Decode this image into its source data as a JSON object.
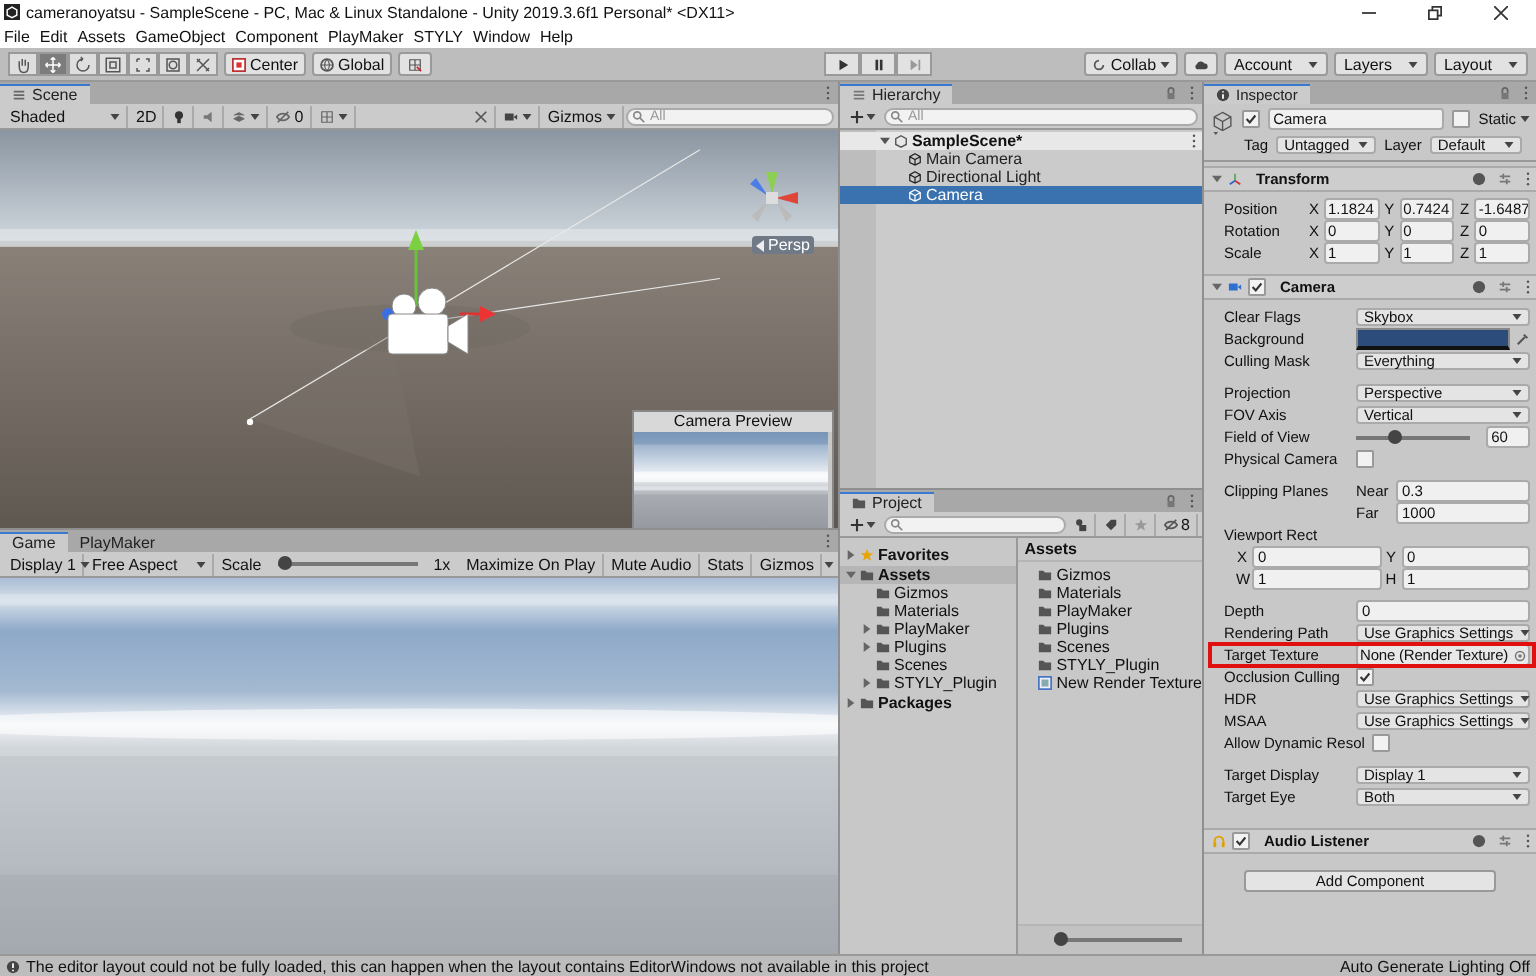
{
  "window": {
    "title": "cameranoyatsu - SampleScene - PC, Mac & Linux Standalone - Unity 2019.3.6f1 Personal* <DX11>"
  },
  "menu": [
    "File",
    "Edit",
    "Assets",
    "GameObject",
    "Component",
    "PlayMaker",
    "STYLY",
    "Window",
    "Help"
  ],
  "toolbar": {
    "tools": [
      {
        "kind": "hand",
        "selected": false
      },
      {
        "kind": "move",
        "selected": true
      },
      {
        "kind": "rotate",
        "selected": false
      },
      {
        "kind": "scale",
        "selected": false
      },
      {
        "kind": "rect",
        "selected": false
      },
      {
        "kind": "transform",
        "selected": false
      },
      {
        "kind": "custom",
        "selected": false
      }
    ],
    "pivot": "Center",
    "space": "Global",
    "collab": "Collab",
    "account": "Account",
    "layers": "Layers",
    "layout": "Layout"
  },
  "scene": {
    "tab": "Scene",
    "shading": "Shaded",
    "mode_2d": "2D",
    "hidden_count": "0",
    "gizmos": "Gizmos",
    "search": {
      "placeholder": "All"
    },
    "view_label": "Persp",
    "preview_title": "Camera Preview"
  },
  "game": {
    "tabs": [
      {
        "label": "Game",
        "selected": true
      },
      {
        "label": "PlayMaker",
        "selected": false
      }
    ],
    "display": "Display 1",
    "aspect": "Free Aspect",
    "scale_label": "Scale",
    "scale": {
      "level": 0.04
    },
    "scale_value": "1x",
    "buttons": [
      "Maximize On Play",
      "Mute Audio",
      "Stats",
      "Gizmos"
    ]
  },
  "hierarchy": {
    "tab": "Hierarchy",
    "search": {
      "placeholder": "All"
    },
    "scene": "SampleScene*",
    "items": [
      {
        "label": "Main Camera",
        "selected": false
      },
      {
        "label": "Directional Light",
        "selected": false
      },
      {
        "label": "Camera",
        "selected": true
      }
    ]
  },
  "project": {
    "tab": "Project",
    "hidden_count": "8",
    "tree": [
      {
        "label": "Favorites",
        "kind": "favorites",
        "expanded": false,
        "selected": false
      },
      {
        "label": "Assets",
        "kind": "folder",
        "expanded": true,
        "selected": true,
        "children": [
          {
            "label": "Gizmos",
            "selected": false
          },
          {
            "label": "Materials",
            "selected": false
          },
          {
            "label": "PlayMaker",
            "expanded": false,
            "selected": false
          },
          {
            "label": "Plugins",
            "expanded": false,
            "selected": false
          },
          {
            "label": "Scenes",
            "selected": false
          },
          {
            "label": "STYLY_Plugin",
            "expanded": false,
            "selected": false
          }
        ]
      },
      {
        "label": "Packages",
        "kind": "folder",
        "expanded": false,
        "selected": false
      }
    ],
    "folder_title": "Assets",
    "assets": [
      {
        "label": "Gizmos",
        "kind": "folder"
      },
      {
        "label": "Materials",
        "kind": "folder"
      },
      {
        "label": "PlayMaker",
        "kind": "folder"
      },
      {
        "label": "Plugins",
        "kind": "folder"
      },
      {
        "label": "Scenes",
        "kind": "folder"
      },
      {
        "label": "STYLY_Plugin",
        "kind": "folder"
      },
      {
        "label": "New Render Texture",
        "kind": "render_texture"
      }
    ],
    "icon_size": {
      "level": 0.05
    }
  },
  "inspector": {
    "tab": "Inspector",
    "object": {
      "active": true,
      "name": "Camera",
      "static_label": "Static",
      "static": false,
      "tag_label": "Tag",
      "tag": "Untagged",
      "layer_label": "Layer",
      "layer": "Default"
    },
    "transform": {
      "title": "Transform",
      "expanded": true,
      "rows": [
        {
          "label": "Position",
          "values": [
            {
              "axis": "X",
              "value": "1.1824"
            },
            {
              "axis": "Y",
              "value": "0.7424"
            },
            {
              "axis": "Z",
              "value": "-1.6487"
            }
          ]
        },
        {
          "label": "Rotation",
          "values": [
            {
              "axis": "X",
              "value": "0"
            },
            {
              "axis": "Y",
              "value": "0"
            },
            {
              "axis": "Z",
              "value": "0"
            }
          ]
        },
        {
          "label": "Scale",
          "values": [
            {
              "axis": "X",
              "value": "1"
            },
            {
              "axis": "Y",
              "value": "1"
            },
            {
              "axis": "Z",
              "value": "1"
            }
          ]
        }
      ]
    },
    "camera": {
      "title": "Camera",
      "enabled": true,
      "expanded": true,
      "groups": [
        [
          {
            "kind": "dropdown",
            "label": "Clear Flags",
            "value": "Skybox"
          },
          {
            "kind": "color",
            "label": "Background",
            "color": "#2c4c7c"
          },
          {
            "kind": "dropdown",
            "label": "Culling Mask",
            "value": "Everything"
          }
        ],
        [
          {
            "kind": "dropdown",
            "label": "Projection",
            "value": "Perspective"
          },
          {
            "kind": "dropdown",
            "label": "FOV Axis",
            "value": "Vertical"
          },
          {
            "kind": "slider",
            "label": "Field of View",
            "level": 0.33,
            "value": "60"
          },
          {
            "kind": "checkbox",
            "label": "Physical Camera",
            "checked": false
          }
        ],
        [
          {
            "kind": "pair",
            "label": "Clipping Planes",
            "rows": [
              {
                "label": "Near",
                "value": "0.3"
              },
              {
                "label": "Far",
                "value": "1000"
              }
            ]
          },
          {
            "kind": "rect",
            "label": "Viewport Rect",
            "rows": [
              [
                {
                  "axis": "X",
                  "value": "0"
                },
                {
                  "axis": "Y",
                  "value": "0"
                }
              ],
              [
                {
                  "axis": "W",
                  "value": "1"
                },
                {
                  "axis": "H",
                  "value": "1"
                }
              ]
            ]
          }
        ],
        [
          {
            "kind": "number",
            "label": "Depth",
            "value": "0"
          },
          {
            "kind": "dropdown",
            "label": "Rendering Path",
            "value": "Use Graphics Settings"
          },
          {
            "kind": "object",
            "label": "Target Texture",
            "value": "None (Render Texture)",
            "highlighted": true
          },
          {
            "kind": "checkbox",
            "label": "Occlusion Culling",
            "checked": true
          },
          {
            "kind": "dropdown",
            "label": "HDR",
            "value": "Use Graphics Settings"
          },
          {
            "kind": "dropdown",
            "label": "MSAA",
            "value": "Use Graphics Settings"
          },
          {
            "kind": "checkbox",
            "label": "Allow Dynamic Resol",
            "checked": false
          }
        ],
        [
          {
            "kind": "dropdown",
            "label": "Target Display",
            "value": "Display 1"
          },
          {
            "kind": "dropdown",
            "label": "Target Eye",
            "value": "Both"
          }
        ]
      ]
    },
    "audio_listener": {
      "title": "Audio Listener",
      "enabled": true
    },
    "add_component": "Add Component"
  },
  "status": {
    "message": "The editor layout could not be fully loaded, this can happen when the layout contains EditorWindows not available in this project",
    "lighting": "Auto Generate Lighting Off"
  }
}
